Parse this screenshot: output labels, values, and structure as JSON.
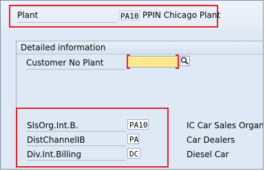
{
  "header": {
    "plant_label": "Plant",
    "plant_value": "PA10",
    "plant_description": "PPIN Chicago Plant"
  },
  "detail_section": {
    "title": "Detailed information",
    "customer_no_plant_label": "Customer No Plant",
    "customer_no_plant_value": "",
    "search_icon": "search-icon"
  },
  "sales_data": {
    "rows": [
      {
        "label": "SlsOrg.Int.B.",
        "value": "PA10",
        "description": "IC Car Sales Organiz"
      },
      {
        "label": "DistChannelIB",
        "value": "PA",
        "description": "Car Dealers"
      },
      {
        "label": "Div.Int.Billing",
        "value": "DC",
        "description": "Diesel Car"
      }
    ]
  },
  "colors": {
    "highlight": "#e0242a",
    "required_field": "#ffe98a",
    "background": "#dfe9f5"
  }
}
